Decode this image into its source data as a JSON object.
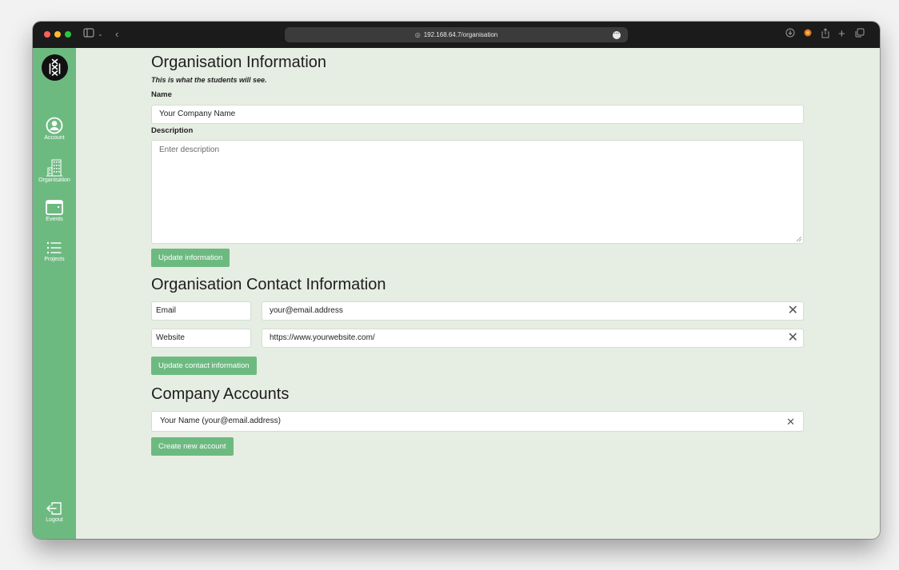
{
  "browser": {
    "url": "192.168.64.7/organisation"
  },
  "sidebar": {
    "items": [
      {
        "label": "Account",
        "icon": "user-circle-icon"
      },
      {
        "label": "Organisation",
        "icon": "building-icon"
      },
      {
        "label": "Events",
        "icon": "calendar-icon"
      },
      {
        "label": "Projects",
        "icon": "list-icon"
      }
    ],
    "logout_label": "Logout"
  },
  "info": {
    "title": "Organisation Information",
    "subtitle": "This is what the students will see.",
    "name_label": "Name",
    "name_value": "Your Company Name",
    "description_label": "Description",
    "description_placeholder": "Enter description",
    "update_button": "Update information"
  },
  "contact": {
    "title": "Organisation Contact Information",
    "rows": [
      {
        "type": "Email",
        "value": "your@email.address"
      },
      {
        "type": "Website",
        "value": "https://www.yourwebsite.com/"
      }
    ],
    "update_button": "Update contact information"
  },
  "accounts": {
    "title": "Company Accounts",
    "items": [
      {
        "label": "Your Name (your@email.address)"
      }
    ],
    "create_button": "Create new account"
  },
  "colors": {
    "accent": "#6dba81",
    "background": "#e6ede2"
  }
}
